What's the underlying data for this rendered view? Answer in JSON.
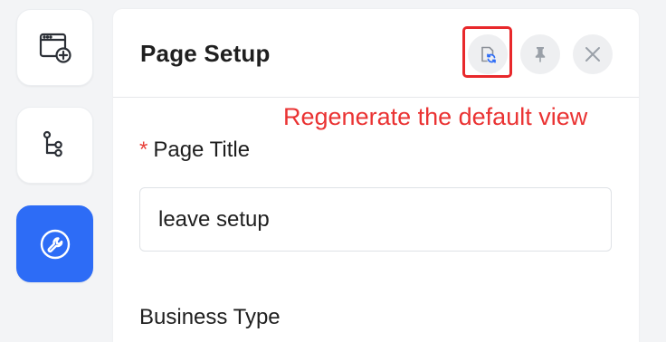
{
  "sidebar": {
    "items": [
      {
        "icon": "window-add-icon",
        "active": false
      },
      {
        "icon": "flow-tree-icon",
        "active": false
      },
      {
        "icon": "wrench-icon",
        "active": true
      }
    ]
  },
  "panel": {
    "title": "Page Setup",
    "header_buttons": [
      {
        "icon": "regenerate-icon"
      },
      {
        "icon": "pin-icon"
      },
      {
        "icon": "close-icon"
      }
    ],
    "annotation": "Regenerate the default view",
    "fields": {
      "page_title": {
        "required_mark": "*",
        "label": "Page Title",
        "value": "leave setup"
      },
      "business_type": {
        "label": "Business Type"
      }
    }
  },
  "colors": {
    "accent": "#2d6cf6",
    "annotation": "#ea3333",
    "required": "#e8413a"
  }
}
